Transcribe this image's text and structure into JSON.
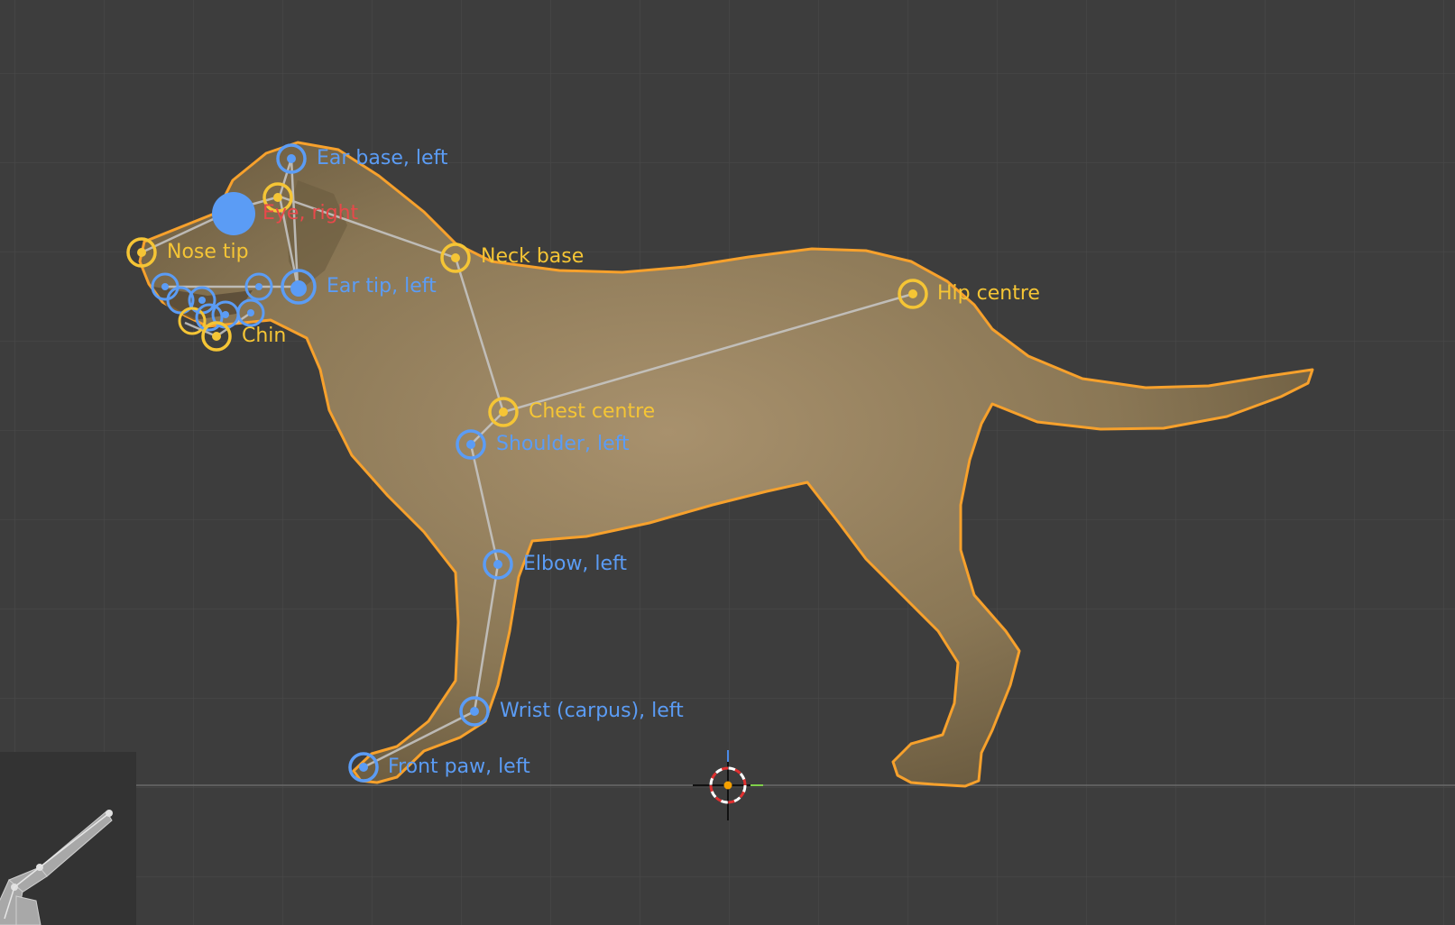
{
  "viewport": {
    "background": "#3d3d3d",
    "grid_color": "#4a4a4a",
    "outline_color": "#f7a12c",
    "bone_color": "#c8c8c8"
  },
  "keypoints": {
    "ear_base_left": {
      "label": "Ear base, left",
      "color": "#5b9cf5"
    },
    "eye_right": {
      "label": "Eye, right",
      "color": "#e8484a"
    },
    "nose_tip": {
      "label": "Nose tip",
      "color": "#f5c535"
    },
    "neck_base": {
      "label": "Neck base",
      "color": "#f5c535"
    },
    "ear_tip_left": {
      "label": "Ear tip, left",
      "color": "#5b9cf5"
    },
    "chin": {
      "label": "Chin",
      "color": "#f5c535"
    },
    "hip_centre": {
      "label": "Hip centre",
      "color": "#f5c535"
    },
    "chest_centre": {
      "label": "Chest centre",
      "color": "#f5c535"
    },
    "shoulder_left": {
      "label": "Shoulder, left",
      "color": "#5b9cf5"
    },
    "elbow_left": {
      "label": "Elbow, left",
      "color": "#5b9cf5"
    },
    "wrist_left": {
      "label": "Wrist (carpus), left",
      "color": "#5b9cf5"
    },
    "front_paw_left": {
      "label": "Front paw, left",
      "color": "#5b9cf5"
    }
  },
  "icons": {
    "cursor": "3d-cursor-icon",
    "armature": "armature-gizmo-icon"
  }
}
